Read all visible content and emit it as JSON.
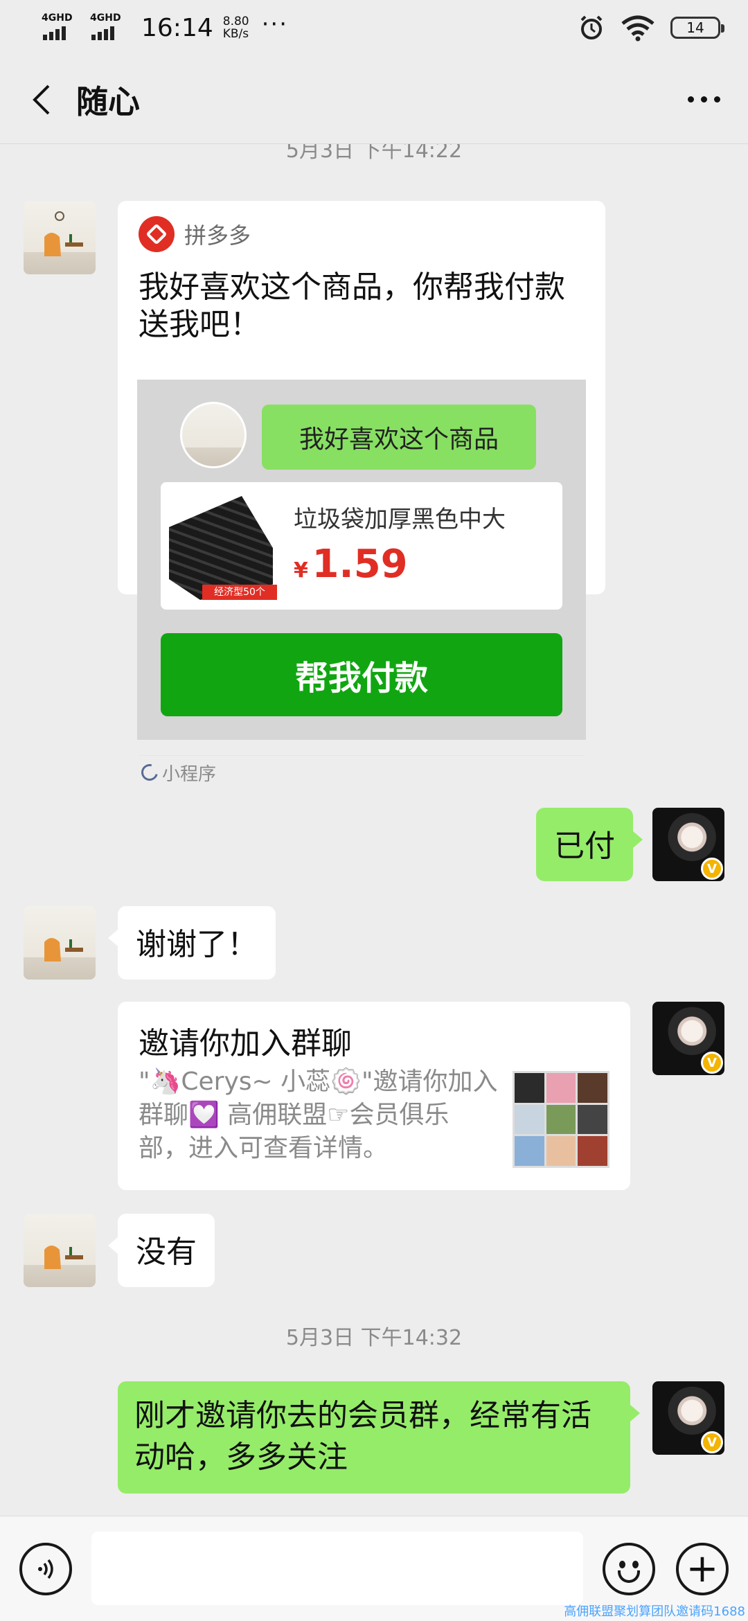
{
  "status_bar": {
    "network_1": "4GHD",
    "network_2": "4GHD",
    "time": "16:14",
    "speed_value": "8.80",
    "speed_unit": "KB/s",
    "battery": "14"
  },
  "header": {
    "title": "随心"
  },
  "chat": {
    "timestamp_1": "5月3日 下午14:22",
    "mini_program": {
      "app_name": "拼多多",
      "title": "我好喜欢这个商品，你帮我付款送我吧！",
      "preview_bubble": "我好喜欢这个商品",
      "product_tag": "经济型50个",
      "product_name": "垃圾袋加厚黑色中大",
      "currency": "¥",
      "price": "1.59",
      "pay_button": "帮我付款",
      "footer_label": "小程序"
    },
    "msg_paid": "已付",
    "msg_thanks": "谢谢了！",
    "invite": {
      "title": "邀请你加入群聊",
      "description": "\"🦄Cerys~ 小蕊🍥\"邀请你加入群聊💟 高佣联盟☞会员俱乐部，进入可查看详情。"
    },
    "msg_no": "没有",
    "timestamp_2": "5月3日 下午14:32",
    "msg_last": "刚才邀请你去的会员群，经常有活动哈，多多关注"
  },
  "watermark": "高佣联盟聚划算团队邀请码1688",
  "icons": {
    "back": "back-arrow-icon",
    "more": "more-icon",
    "voice": "voice-icon",
    "emoji": "emoji-icon",
    "plus": "plus-icon"
  },
  "colors": {
    "background": "#EDEDED",
    "sent_bubble": "#95EC69",
    "received_bubble": "#FFFFFF",
    "pay_button": "#11A611",
    "price": "#E02E24"
  }
}
